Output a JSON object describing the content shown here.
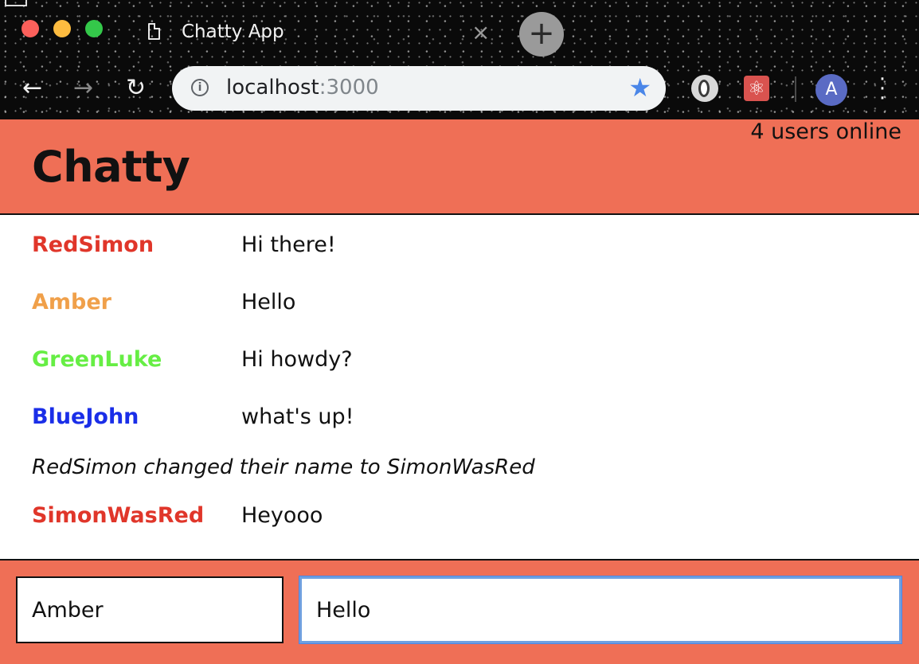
{
  "browser": {
    "tab_title": "Chatty App",
    "tab_close": "×",
    "new_tab": "+",
    "url_host": "localhost",
    "url_port": ":3000",
    "avatar_letter": "A",
    "icons": [
      "back-arrow-icon",
      "forward-arrow-icon",
      "reload-icon",
      "info-icon",
      "star-icon",
      "extension-icon",
      "react-devtools-icon",
      "profile-avatar",
      "more-menu-icon"
    ]
  },
  "header": {
    "brand": "Chatty",
    "online": "4 users online"
  },
  "messages": [
    {
      "type": "message",
      "user": "RedSimon",
      "content": "Hi there!",
      "color": "#e0362a"
    },
    {
      "type": "message",
      "user": "Amber",
      "content": "Hello",
      "color": "#f0a04a"
    },
    {
      "type": "message",
      "user": "GreenLuke",
      "content": "Hi howdy?",
      "color": "#66ee44"
    },
    {
      "type": "message",
      "user": "BlueJohn",
      "content": "what's up!",
      "color": "#1a2ee8"
    },
    {
      "type": "notification",
      "content": "RedSimon changed their name to SimonWasRed"
    },
    {
      "type": "message",
      "user": "SimonWasRed",
      "content": "Heyooo",
      "color": "#e0362a"
    }
  ],
  "composer": {
    "username_value": "Amber",
    "message_value": "Hello"
  },
  "colors": {
    "accent": "#ef6f56",
    "focus_border": "#6fa0e0"
  }
}
